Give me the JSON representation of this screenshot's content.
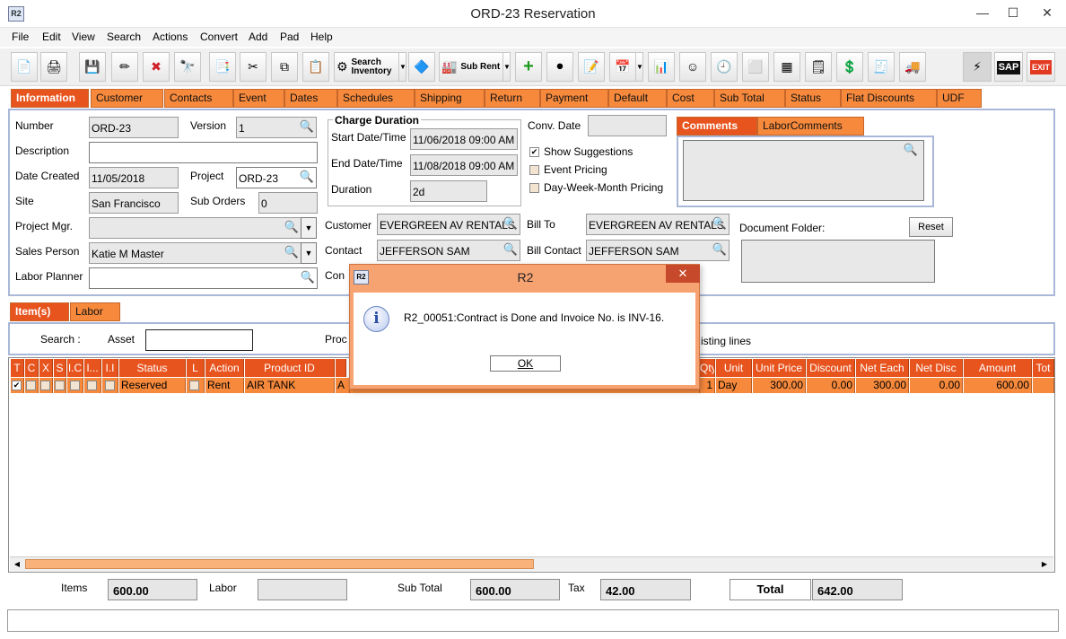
{
  "window": {
    "title": "ORD-23 Reservation",
    "icon_text": "R2",
    "minimize": "—",
    "maximize": "☐",
    "close": "✕"
  },
  "menu": [
    "File",
    "Edit",
    "View",
    "Search",
    "Actions",
    "Convert",
    "Add",
    "Pad",
    "Help"
  ],
  "toolbar": {
    "search_inventory_1": "Search",
    "search_inventory_2": "Inventory",
    "sub_rent": "Sub Rent",
    "sap": "SAP",
    "exit": "EXIT"
  },
  "tabs": [
    "Information",
    "Customer",
    "Contacts",
    "Event",
    "Dates",
    "Schedules",
    "Shipping",
    "Return",
    "Payment",
    "Default",
    "Cost",
    "Sub Total",
    "Status",
    "Flat Discounts",
    "UDF"
  ],
  "info": {
    "number_label": "Number",
    "number": "ORD-23",
    "version_label": "Version",
    "version": "1",
    "description_label": "Description",
    "description": "",
    "date_created_label": "Date Created",
    "date_created": "11/05/2018",
    "project_label": "Project",
    "project": "ORD-23",
    "site_label": "Site",
    "site": "San Francisco",
    "sub_orders_label": "Sub Orders",
    "sub_orders": "0",
    "project_mgr_label": "Project Mgr.",
    "project_mgr": "",
    "sales_person_label": "Sales Person",
    "sales_person": "Katie M Master",
    "labor_planner_label": "Labor Planner",
    "labor_planner": ""
  },
  "charge_duration": {
    "title": "Charge Duration",
    "start_label": "Start Date/Time",
    "start": "11/06/2018 09:00 AM",
    "end_label": "End Date/Time",
    "end": "11/08/2018 09:00 AM",
    "duration_label": "Duration",
    "duration": "2d"
  },
  "options": {
    "conv_date_label": "Conv. Date",
    "conv_date": "",
    "show_suggestions": "Show Suggestions",
    "show_suggestions_checked": true,
    "event_pricing": "Event Pricing",
    "event_pricing_checked": false,
    "dwm_pricing": "Day-Week-Month Pricing",
    "dwm_pricing_checked": false
  },
  "customer": {
    "customer_label": "Customer",
    "customer": "EVERGREEN AV RENTALS",
    "contact_label": "Contact",
    "contact": "JEFFERSON SAM",
    "bill_to_label": "Bill To",
    "bill_to": "EVERGREEN AV RENTALS",
    "bill_contact_label": "Bill Contact",
    "bill_contact": "JEFFERSON SAM",
    "hidden_label_partial": "Con"
  },
  "comments_tabs": [
    "Comments",
    "LaborComments"
  ],
  "document_folder_label": "Document Folder:",
  "reset_label": "Reset",
  "lower_tabs": [
    "Item(s)",
    "Labor"
  ],
  "search_bar": {
    "search_label": "Search :",
    "asset_label": "Asset",
    "asset_value": "",
    "prod_partial": "Proc",
    "existing_lines_partial": "isting lines"
  },
  "grid": {
    "columns": [
      "T",
      "C",
      "X",
      "S",
      "I.C",
      "I...",
      "I.I",
      "Status",
      "L",
      "Action",
      "Product ID",
      "",
      "Qty",
      "Unit",
      "Unit Price",
      "Discount",
      "Net Each",
      "Net Disc",
      "Amount",
      "Tot"
    ],
    "rows": [
      {
        "t_checked": true,
        "status": "Reserved",
        "action": "Rent",
        "product_id": "AIR TANK",
        "desc_partial": "A",
        "qty": "1",
        "unit": "Day",
        "unit_price": "300.00",
        "discount": "0.00",
        "net_each": "300.00",
        "net_disc": "0.00",
        "amount": "600.00"
      }
    ]
  },
  "dialog": {
    "title": "R2",
    "icon_text": "R2",
    "info_icon": "i",
    "message": "R2_00051:Contract is Done and Invoice No. is INV-16.",
    "ok": "OK",
    "close": "✕"
  },
  "footer": {
    "items_label": "Items",
    "items": "600.00",
    "labor_label": "Labor",
    "labor": "",
    "sub_total_label": "Sub Total",
    "sub_total": "600.00",
    "tax_label": "Tax",
    "tax": "42.00",
    "total_label": "Total",
    "total": "642.00"
  }
}
